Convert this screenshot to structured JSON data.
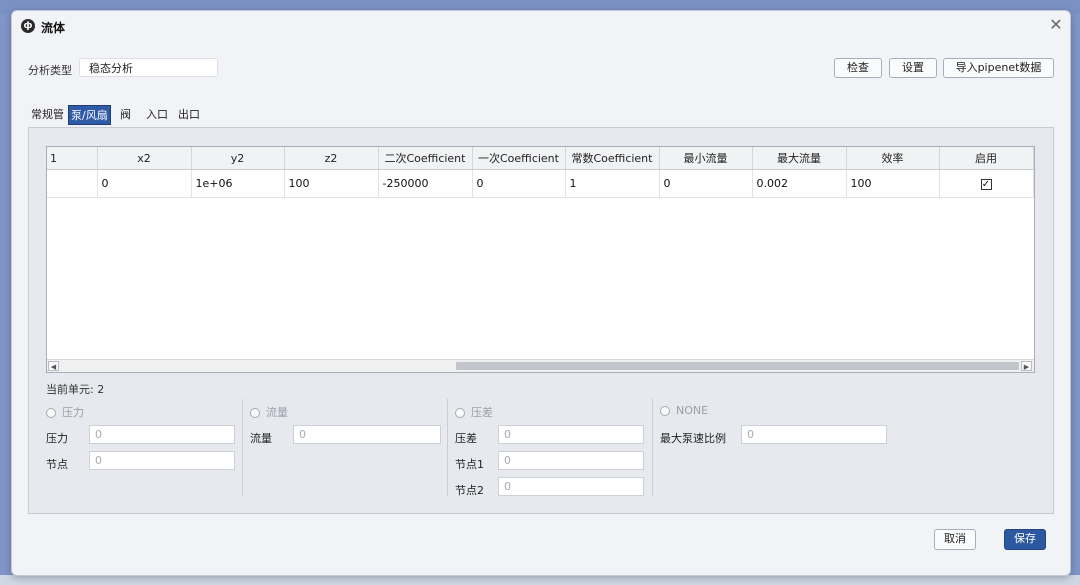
{
  "window": {
    "title": "流体",
    "app_icon_glyph": "ф"
  },
  "analysis": {
    "label": "分析类型",
    "value": "稳态分析"
  },
  "toolbar": {
    "check_label": "检查",
    "settings_label": "设置",
    "import_label": "导入pipenet数据"
  },
  "tabs": [
    {
      "label": "常规管",
      "active": false
    },
    {
      "label": "泵/风扇",
      "active": true
    },
    {
      "label": "阀",
      "active": false
    },
    {
      "label": "入口",
      "active": false
    },
    {
      "label": "出口",
      "active": false
    }
  ],
  "table": {
    "corner": "1",
    "columns": [
      "x2",
      "y2",
      "z2",
      "二次Coefficient",
      "一次Coefficient",
      "常数Coefficient",
      "最小流量",
      "最大流量",
      "效率",
      "启用"
    ],
    "rows": [
      [
        "0",
        "1e+06",
        "100",
        "-250000",
        "0",
        "1",
        "0",
        "0.002",
        "100"
      ]
    ],
    "enabled_checked": true
  },
  "current_cell": {
    "label": "当前单元:",
    "value": "2"
  },
  "groups": {
    "pressure": {
      "radio": "压力",
      "field1_label": "压力",
      "field1_value": "0",
      "field2_label": "节点",
      "field2_value": "0"
    },
    "flow": {
      "radio": "流量",
      "field1_label": "流量",
      "field1_value": "0"
    },
    "pressure_diff": {
      "radio": "压差",
      "field1_label": "压差",
      "field1_value": "0",
      "field2_label": "节点1",
      "field2_value": "0",
      "field3_label": "节点2",
      "field3_value": "0"
    },
    "none": {
      "radio": "NONE",
      "field1_label": "最大泵速比例",
      "field1_value": "0"
    }
  },
  "footer": {
    "cancel_label": "取消",
    "save_label": "保存"
  }
}
